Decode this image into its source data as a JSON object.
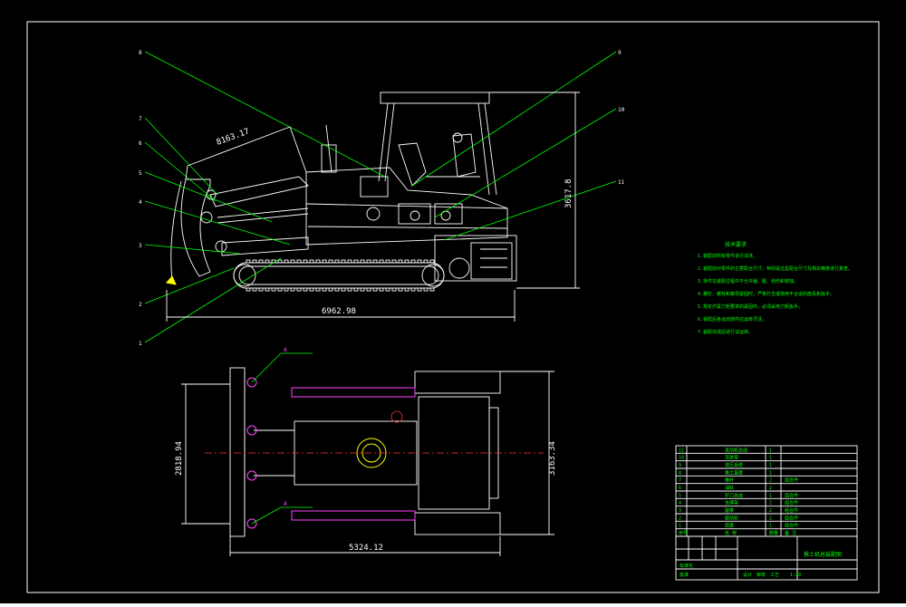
{
  "drawing": {
    "side_view": {
      "dim_overall_length": "6962.98",
      "dim_height": "3617.8",
      "dim_diagonal": "8163.17",
      "callouts": [
        "8",
        "7",
        "6",
        "5",
        "4",
        "3",
        "2",
        "1",
        "9",
        "10",
        "11"
      ]
    },
    "top_view": {
      "dim_length": "5324.12",
      "dim_blade_width": "2818.94",
      "dim_track_width": "3163.34",
      "section_marks": [
        "A",
        "A"
      ]
    },
    "tech_notes": {
      "title": "技术要求",
      "lines": [
        "1.装配前所有零件进行清洗。",
        "2.装配前对零件的主要配合尺寸，特别是过盈配合尺寸及相关精度进行复查。",
        "3.零件在装配过程中不允许磕、碰、划伤和锈蚀。",
        "4.螺钉、螺栓和螺母紧固时，严禁打击或使用不合适的旋具和扳手。",
        "5.规定拧紧力矩要求的紧固件，必须采用力矩扳手。",
        "6.装配后各运动部件应运转灵活。",
        "7.装配完成后进行试运转。"
      ]
    },
    "bom": {
      "rows": [
        {
          "no": "11",
          "name": "发动机总成",
          "qty": "1",
          "note": ""
        },
        {
          "no": "10",
          "name": "驾驶室",
          "qty": "1",
          "note": ""
        },
        {
          "no": "9",
          "name": "液压系统",
          "qty": "1",
          "note": ""
        },
        {
          "no": "8",
          "name": "推土装置",
          "qty": "1",
          "note": ""
        },
        {
          "no": "7",
          "name": "推杆",
          "qty": "2",
          "note": "组合件"
        },
        {
          "no": "6",
          "name": "油缸",
          "qty": "2",
          "note": ""
        },
        {
          "no": "5",
          "name": "铲刀总成",
          "qty": "1",
          "note": "组合件"
        },
        {
          "no": "4",
          "name": "支撑架",
          "qty": "2",
          "note": "组合件"
        },
        {
          "no": "3",
          "name": "履带",
          "qty": "2",
          "note": "组合件"
        },
        {
          "no": "2",
          "name": "驱动轮",
          "qty": "2",
          "note": "组合件"
        },
        {
          "no": "1",
          "name": "底盘",
          "qty": "1",
          "note": "组合件"
        }
      ],
      "header": {
        "no": "序号",
        "name": "名 称",
        "qty": "数量",
        "note": "备 注"
      }
    },
    "title_block": {
      "drawing_title": "推土机总装配图",
      "scale": "1:20",
      "sheet": "1",
      "labels": [
        "设计",
        "审核",
        "工艺",
        "标准化",
        "批准"
      ]
    }
  }
}
